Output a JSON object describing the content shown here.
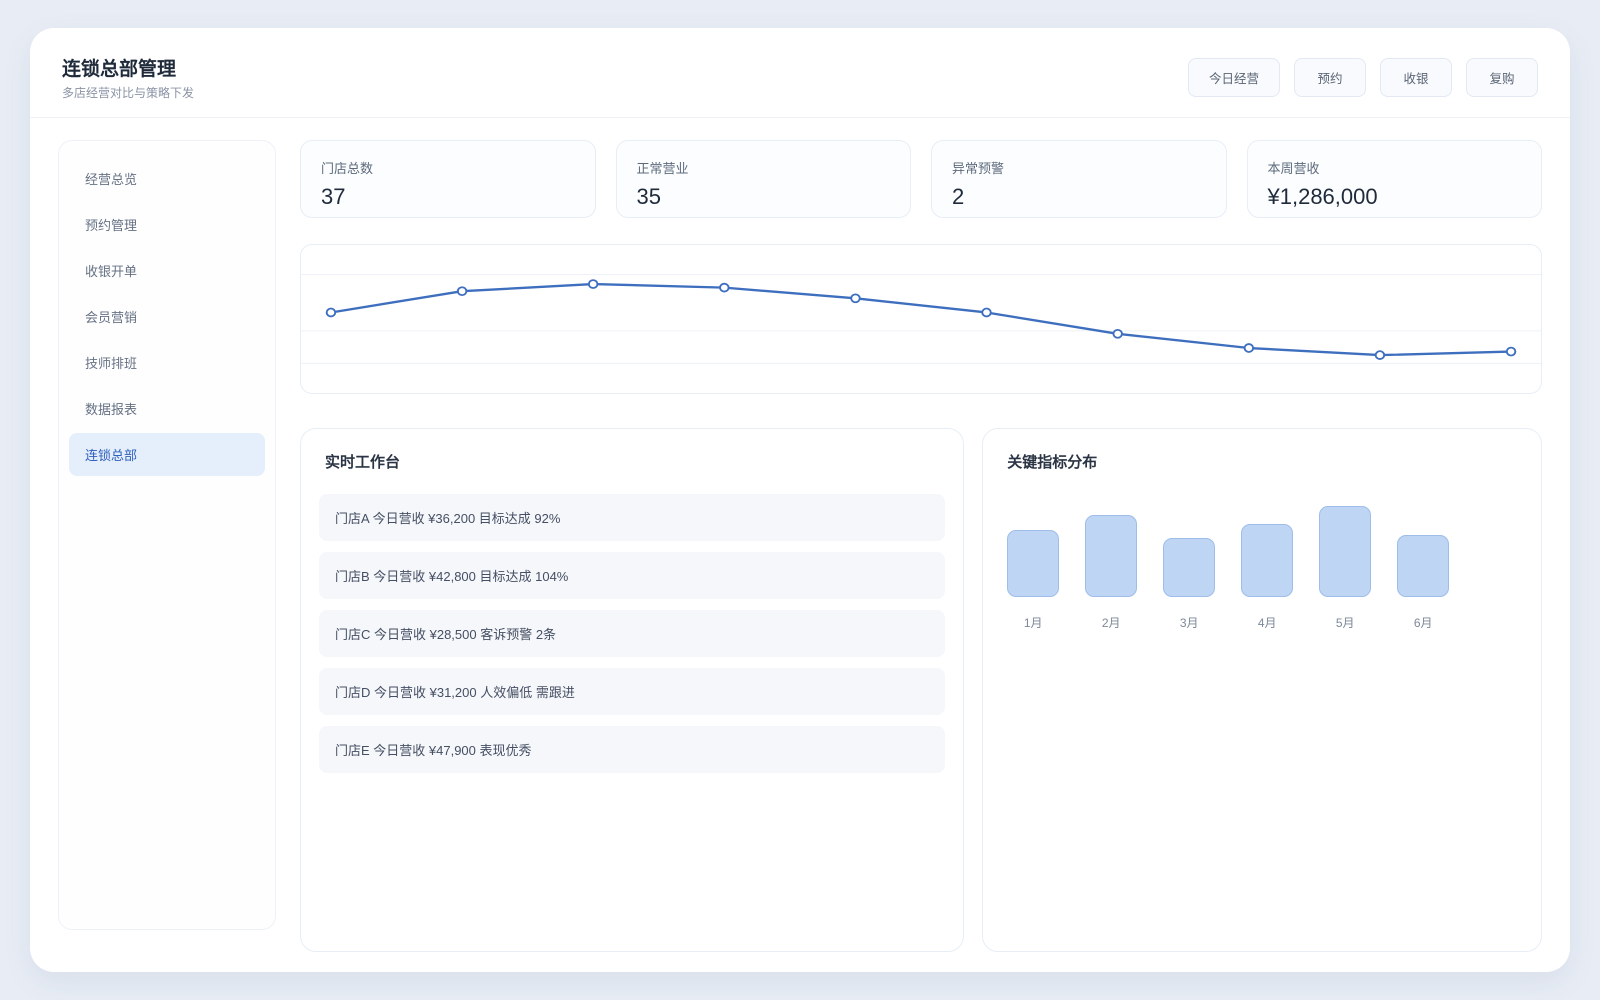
{
  "header": {
    "title": "连锁总部管理",
    "subtitle": "多店经营对比与策略下发",
    "buttons": [
      "今日经营",
      "预约",
      "收银",
      "复购"
    ]
  },
  "sidebar": {
    "items": [
      "经营总览",
      "预约管理",
      "收银开单",
      "会员营销",
      "技师排班",
      "数据报表",
      "连锁总部"
    ],
    "active_item": "连锁总部"
  },
  "stats": [
    {
      "label": "门店总数",
      "value": "37"
    },
    {
      "label": "正常营业",
      "value": "35"
    },
    {
      "label": "异常预警",
      "value": "2"
    },
    {
      "label": "本周营收",
      "value": "¥1,286,000"
    }
  ],
  "workbench": {
    "title": "实时工作台",
    "items": [
      "门店A 今日营收 ¥36,200 目标达成 92%",
      "门店B 今日营收 ¥42,800 目标达成 104%",
      "门店C 今日营收 ¥28,500 客诉预警 2条",
      "门店D 今日营收 ¥31,200 人效偏低 需跟进",
      "门店E 今日营收 ¥47,900 表现优秀"
    ]
  },
  "metrics": {
    "title": "关键指标分布"
  },
  "chart_data": [
    {
      "type": "line",
      "title": "",
      "x": [
        1,
        2,
        3,
        4,
        5,
        6,
        7,
        8,
        9,
        10
      ],
      "values": [
        62,
        74,
        78,
        76,
        70,
        62,
        50,
        42,
        38,
        40
      ],
      "ylim": [
        30,
        90
      ],
      "grid": true,
      "legend_position": "none"
    },
    {
      "type": "bar",
      "title": "关键指标分布",
      "categories": [
        "1月",
        "2月",
        "3月",
        "4月",
        "5月",
        "6月"
      ],
      "values": [
        67,
        82,
        59,
        73,
        91,
        62
      ],
      "ylim": [
        0,
        100
      ],
      "grid": false
    }
  ],
  "colors": {
    "accent": "#3e6fbf",
    "bar_fill": "#bfd5f4",
    "bar_border": "#9fbde9",
    "active_nav_bg": "#e5eefb",
    "active_nav_text": "#3061bd",
    "grid_line": "#edf1f7"
  }
}
